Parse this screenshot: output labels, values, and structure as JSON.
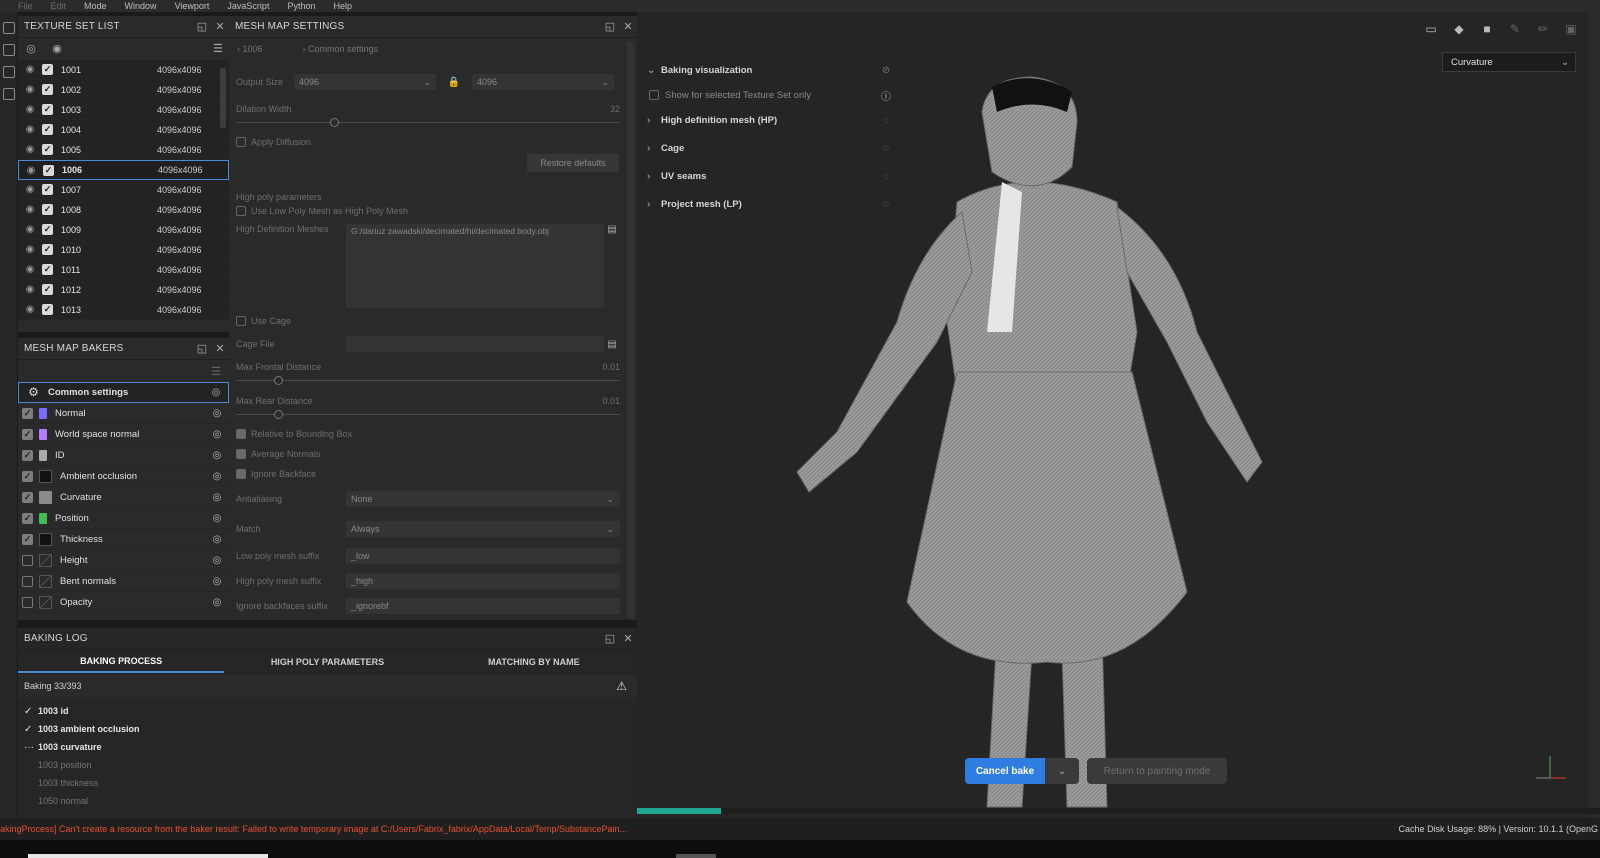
{
  "menu": [
    "File",
    "Edit",
    "Mode",
    "Window",
    "Viewport",
    "JavaScript",
    "Python",
    "Help"
  ],
  "texture_set_list": {
    "title": "TEXTURE SET LIST",
    "rows": [
      {
        "name": "1001",
        "res": "4096x4096"
      },
      {
        "name": "1002",
        "res": "4096x4096"
      },
      {
        "name": "1003",
        "res": "4096x4096"
      },
      {
        "name": "1004",
        "res": "4096x4096"
      },
      {
        "name": "1005",
        "res": "4096x4096"
      },
      {
        "name": "1006",
        "res": "4096x4096"
      },
      {
        "name": "1007",
        "res": "4096x4096"
      },
      {
        "name": "1008",
        "res": "4096x4096"
      },
      {
        "name": "1009",
        "res": "4096x4096"
      },
      {
        "name": "1010",
        "res": "4096x4096"
      },
      {
        "name": "1011",
        "res": "4096x4096"
      },
      {
        "name": "1012",
        "res": "4096x4096"
      },
      {
        "name": "1013",
        "res": "4096x4096"
      }
    ]
  },
  "mesh_map_bakers": {
    "title": "MESH MAP BAKERS",
    "items": [
      {
        "name": "Common settings",
        "color": "#cccccc"
      },
      {
        "name": "Normal",
        "color": "#7b6cff"
      },
      {
        "name": "World space normal",
        "color": "#b47cff"
      },
      {
        "name": "ID",
        "color": "#aaaaaa"
      },
      {
        "name": "Ambient occlusion",
        "color": "#111111"
      },
      {
        "name": "Curvature",
        "color": "#8a8a8a"
      },
      {
        "name": "Position",
        "color": "#3fbf4f"
      },
      {
        "name": "Thickness",
        "color": "#111111"
      },
      {
        "name": "Height",
        "color": "#3a3a3a"
      },
      {
        "name": "Bent normals",
        "color": "#3a3a3a"
      },
      {
        "name": "Opacity",
        "color": "#3a3a3a"
      }
    ]
  },
  "mesh_map_settings": {
    "title": "MESH MAP SETTINGS",
    "crumb_set": "1006",
    "crumb_section": "Common settings",
    "output_size_label": "Output Size",
    "output_size_a": "4096",
    "output_size_b": "4096",
    "dilation_label": "Dilation Width",
    "dilation_value": "32",
    "apply_diffusion": "Apply Diffusion",
    "restore_defaults": "Restore defaults",
    "hp_params": "High poly parameters",
    "use_low_poly": "Use Low Poly Mesh as High Poly Mesh",
    "hd_meshes_label": "High Definition Meshes",
    "hd_meshes_value": "G:/dariuz zawadski/decimated/hi/decimated body.obj",
    "use_cage": "Use Cage",
    "cage_file": "Cage File",
    "max_frontal": "Max Frontal Distance",
    "max_frontal_value": "0.01",
    "max_rear": "Max Rear Distance",
    "max_rear_value": "0.01",
    "relative_bbox": "Relative to Bounding Box",
    "average_normals": "Average Normals",
    "ignore_backface": "Ignore Backface",
    "antialiasing": "Antialiasing",
    "antialiasing_value": "None",
    "match": "Match",
    "match_value": "Always",
    "low_suffix": "Low poly mesh suffix",
    "low_suffix_value": "_low",
    "high_suffix": "High poly mesh suffix",
    "high_suffix_value": "_high",
    "ignore_suffix": "Ignore backfaces suffix",
    "ignore_suffix_value": "_ignorebf"
  },
  "baking_log": {
    "title": "BAKING LOG",
    "tabs": [
      "BAKING PROCESS",
      "HIGH POLY PARAMETERS",
      "MATCHING BY NAME"
    ],
    "progress": "Baking 33/393",
    "items": [
      {
        "mark": "✓",
        "text": "1003 id",
        "state": "done"
      },
      {
        "mark": "✓",
        "text": "1003 ambient occlusion",
        "state": "done"
      },
      {
        "mark": "···",
        "text": "1003 curvature",
        "state": "active"
      },
      {
        "mark": "",
        "text": "1003 position",
        "state": "wait"
      },
      {
        "mark": "",
        "text": "1003 thickness",
        "state": "wait"
      },
      {
        "mark": "",
        "text": "1050 normal",
        "state": "wait"
      }
    ]
  },
  "viewport": {
    "baking_visualization": "Baking visualization",
    "show_selected": "Show for selected Texture Set only",
    "sections": [
      "High definition mesh (HP)",
      "Cage",
      "UV seams",
      "Project mesh (LP)"
    ],
    "channel": "Curvature",
    "cancel_bake": "Cancel bake",
    "return_paint": "Return to painting mode",
    "progress_fraction": 0.087
  },
  "status": {
    "error": "akingProcess] Can't create a resource from the baker result: Failed to write temporary image at C:/Users/Fabrix_fabrix/AppData/Local/Temp/SubstancePain...",
    "info": "Cache Disk Usage:    88% | Version: 10.1.1 (OpenG"
  }
}
